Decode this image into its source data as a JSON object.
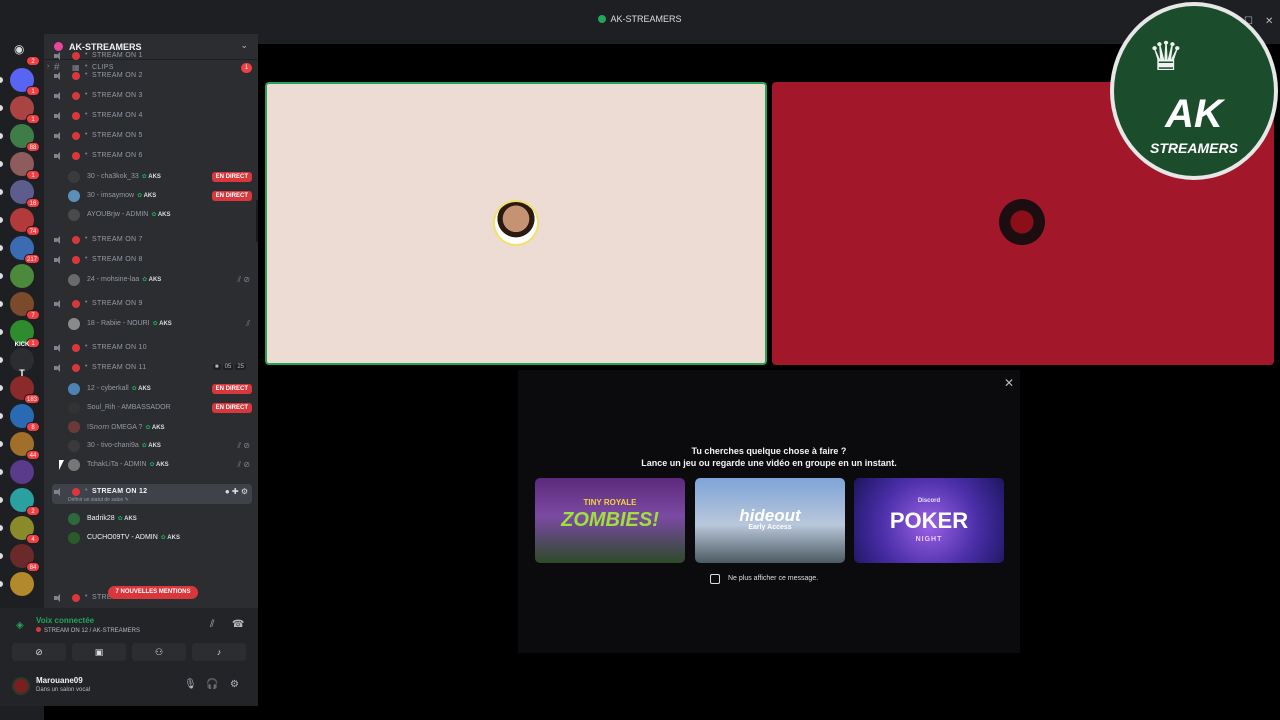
{
  "window": {
    "title": "AK-STREAMERS"
  },
  "servers": [
    {
      "badge": "1",
      "color": "#5865f2"
    },
    {
      "badge": "1",
      "color": "#a94442"
    },
    {
      "badge": "88",
      "color": "#3e7d47"
    },
    {
      "badge": "1",
      "color": "#8e5c5c"
    },
    {
      "badge": "16",
      "color": "#5c5c8e"
    },
    {
      "badge": "74",
      "color": "#b33a3a"
    },
    {
      "badge": "217",
      "color": "#3a6bb3"
    },
    {
      "badge": "",
      "color": "#4a8a3a"
    },
    {
      "badge": "7",
      "color": "#7a4a2a"
    },
    {
      "badge": "1",
      "color": "#2e8b2e"
    },
    {
      "badge": "",
      "color": "#2b2d31"
    },
    {
      "badge": "183",
      "color": "#8a2a2a"
    },
    {
      "badge": "8",
      "color": "#2a6ab3"
    },
    {
      "badge": "44",
      "color": "#a0702a"
    },
    {
      "badge": "",
      "color": "#5a3a8a"
    },
    {
      "badge": "2",
      "color": "#2aa0a0"
    },
    {
      "badge": "4",
      "color": "#8a8a2a"
    },
    {
      "badge": "84",
      "color": "#6a2a2a"
    },
    {
      "badge": "",
      "color": "#b38a2a"
    }
  ],
  "server_badges_text": {
    "kick": "KICK",
    "t": "T",
    "new": "NOUVEAU"
  },
  "guild": {
    "name": "AK-STREAMERS",
    "clips": {
      "label": "CLIPS",
      "badge": "1"
    },
    "channels": [
      {
        "name": "STREAM ON 1"
      },
      {
        "name": "STREAM ON 2"
      },
      {
        "name": "STREAM ON 3"
      },
      {
        "name": "STREAM ON 4"
      },
      {
        "name": "STREAM ON 5"
      },
      {
        "name": "STREAM ON 6"
      },
      {
        "name": "STREAM ON 7"
      },
      {
        "name": "STREAM ON 8"
      },
      {
        "name": "STREAM ON 9"
      },
      {
        "name": "STREAM ON 10"
      },
      {
        "name": "STREAM ON 11"
      },
      {
        "name": "STREAM ON 12"
      }
    ],
    "ch11_counts": {
      "cam": "05",
      "total": "25"
    },
    "users": [
      {
        "name": "30 - cha3kok_33",
        "tag": "AKS",
        "live": "EN DIRECT"
      },
      {
        "name": "30 - imsaymow",
        "tag": "AKS",
        "live": "EN DIRECT"
      },
      {
        "name": "AYOUBrjw - ADMIN",
        "tag": "AKS",
        "live": ""
      },
      {
        "name": "24 - mohsine-laa",
        "tag": "AKS",
        "live": ""
      },
      {
        "name": "18 - Rabiie - NOURI",
        "tag": "AKS",
        "live": ""
      },
      {
        "name": "12 - cyberkall",
        "tag": "AKS",
        "live": "EN DIRECT"
      },
      {
        "name": "Soul_Rih - AMBASSADOR",
        "tag": "",
        "live": "EN DIRECT"
      },
      {
        "name": "!S𝘯𝘰𝘮 ΩMEGA ?",
        "tag": "AKS",
        "live": ""
      },
      {
        "name": "30 - tivo-chani9a",
        "tag": "AKS",
        "live": ""
      },
      {
        "name": "TchakLiTa - ADMIN",
        "tag": "AKS",
        "live": ""
      },
      {
        "name": "Badrik28",
        "tag": "AKS",
        "live": ""
      },
      {
        "name": "CUCHO09TV - ADMIN",
        "tag": "AKS",
        "live": ""
      }
    ],
    "ch12_status": "Définir un statut de salon",
    "mentions": "7 NOUVELLES MENTIONS",
    "partial_channel": "STRE"
  },
  "voice": {
    "status": "Voix connectée",
    "channel": "STREAM ON 12 / AK-STREAMERS"
  },
  "user": {
    "name": "Marouane09",
    "status": "Dans un salon vocal"
  },
  "logo": {
    "line1": "AK",
    "line2": "STREAMERS"
  },
  "activity": {
    "line1": "Tu cherches quelque chose à faire ?",
    "line2": "Lance un jeu ou regarde une vidéo en groupe en un instant.",
    "cards": [
      {
        "sub": "TINY ROYALE",
        "main": "ZOMBIES!"
      },
      {
        "main": "hideout",
        "sub": "Early Access"
      },
      {
        "brand": "Discord",
        "main": "POKER",
        "sub": "NIGHT"
      }
    ],
    "checkbox_label": "Ne plus afficher ce message."
  },
  "icons": {
    "speaker": "speaker-icon",
    "mute": "mic-muted-icon",
    "camera": "camera-icon",
    "settings": "gear-icon"
  },
  "colors": {
    "accent_green": "#23a559",
    "danger": "#da373c",
    "tile_left": "#eddcd3",
    "tile_right": "#a3172a"
  }
}
